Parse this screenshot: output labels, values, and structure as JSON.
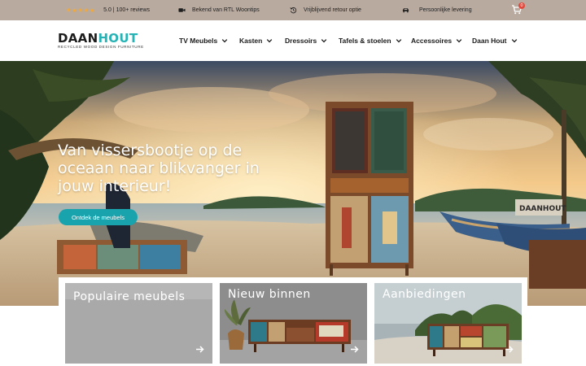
{
  "topbar": {
    "rating_stars": "★★★★★",
    "rating_text": "5.0 | 100+ reviews",
    "usp1": "Bekend van RTL Woontips",
    "usp2": "Vrijblijvend retour optie",
    "usp3": "Persoonlijke levering",
    "cart_count": "0"
  },
  "header": {
    "logo_part1": "DAAN",
    "logo_part2": "HOUT",
    "logo_tagline": "RECYCLED WOOD DESIGN FURNITURE",
    "nav": [
      "TV Meubels",
      "Kasten",
      "Dressoirs",
      "Tafels & stoelen",
      "Accessoires",
      "Daan Hout"
    ]
  },
  "hero": {
    "title": "Van vissersbootje op de oceaan naar blikvanger in jouw interieur!",
    "cta": "Ontdek de meubels",
    "boat_name": "DAANHOUT"
  },
  "cards": [
    {
      "title": "Populaire meubels"
    },
    {
      "title": "Nieuw binnen"
    },
    {
      "title": "Aanbiedingen"
    }
  ],
  "colors": {
    "topbar_bg": "#b8aa9f",
    "accent": "#18a3ad",
    "logo_accent": "#27b3b5",
    "star": "#f1a93a"
  }
}
